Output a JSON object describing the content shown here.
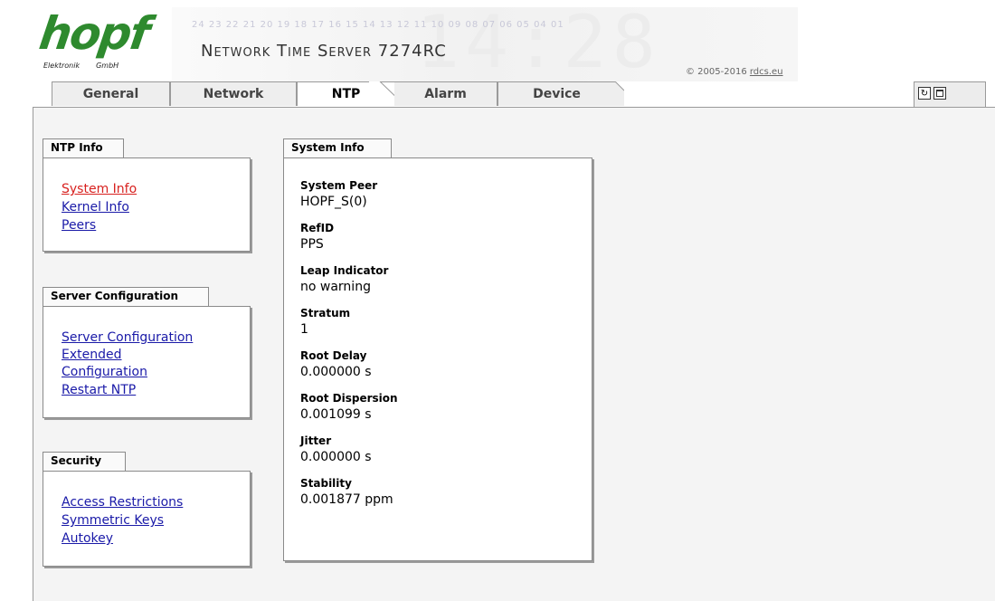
{
  "brand": {
    "logo_text": "hopf",
    "logo_sub_left": "Elektronik",
    "logo_sub_right": "GmbH",
    "product_title": "Network Time Server 7274RC",
    "banner_digits": "24 23 22 21 20 19 18 17 16 15 14 13 12 11 10 09 08 07 06 05 04 01",
    "banner_clock": "14:28",
    "copyright_prefix": "© 2005-2016 ",
    "copyright_link": "rdcs.eu"
  },
  "tabs": [
    {
      "label": "General"
    },
    {
      "label": "Network"
    },
    {
      "label": "NTP"
    },
    {
      "label": "Alarm"
    },
    {
      "label": "Device"
    }
  ],
  "active_tab": "NTP",
  "view_buttons": {
    "refresh_icon": "↻",
    "window_icon": "window-icon"
  },
  "colors": {
    "brand_green": "#2e8a2e",
    "link_blue": "#1a1aa8",
    "link_active_red": "#d8211f"
  },
  "nav": {
    "ntp_info": {
      "title": "NTP Info",
      "links": [
        "System Info",
        "Kernel Info",
        "Peers"
      ]
    },
    "server_config": {
      "title": "Server Configuration",
      "links": [
        "Server Configuration",
        "Extended Configuration",
        "Restart NTP"
      ]
    },
    "security": {
      "title": "Security",
      "links": [
        "Access Restrictions",
        "Symmetric Keys",
        "Autokey"
      ]
    }
  },
  "system_info": {
    "title": "System Info",
    "fields": [
      {
        "label": "System Peer",
        "value": "HOPF_S(0)"
      },
      {
        "label": "RefID",
        "value": "PPS"
      },
      {
        "label": "Leap Indicator",
        "value": "no warning"
      },
      {
        "label": "Stratum",
        "value": "1"
      },
      {
        "label": "Root Delay",
        "value": "0.000000 s"
      },
      {
        "label": "Root Dispersion",
        "value": "0.001099 s"
      },
      {
        "label": "Jitter",
        "value": "0.000000 s"
      },
      {
        "label": "Stability",
        "value": "0.001877 ppm"
      }
    ]
  }
}
